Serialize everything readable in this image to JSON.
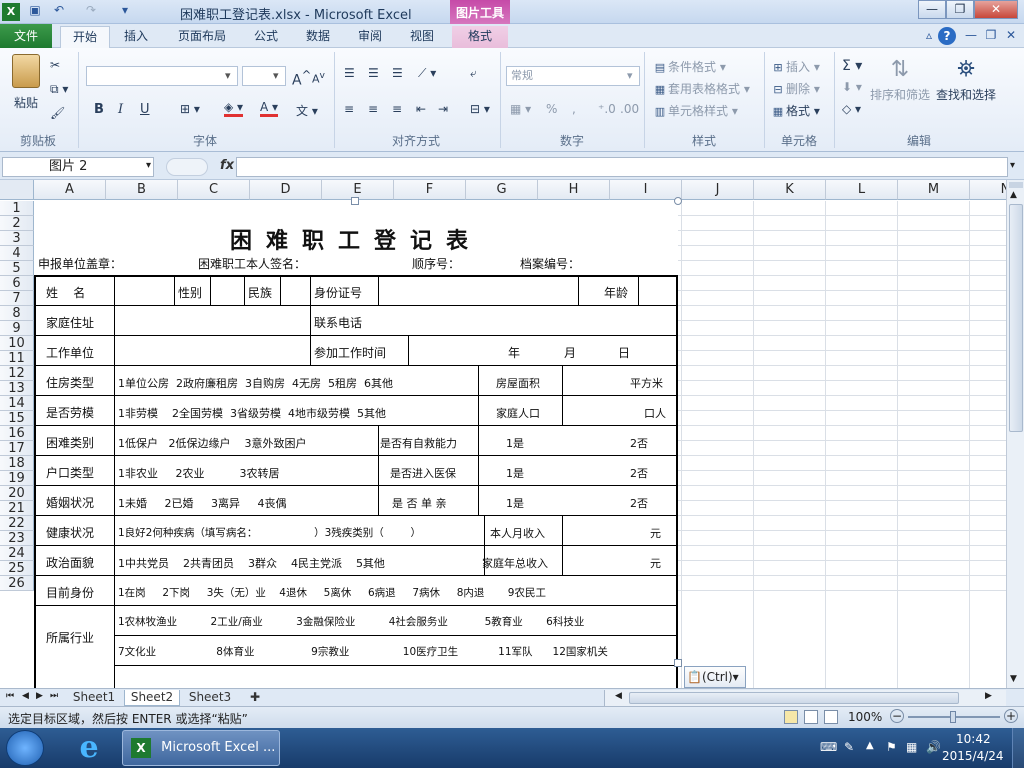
{
  "window": {
    "title": "困难职工登记表.xlsx - Microsoft Excel",
    "picture_tools": "图片工具",
    "min": "—",
    "restore": "❐",
    "close": "✕"
  },
  "tabs": {
    "file": "文件",
    "home": "开始",
    "insert": "插入",
    "page_layout": "页面布局",
    "formulas": "公式",
    "data": "数据",
    "review": "审阅",
    "view": "视图",
    "format": "格式"
  },
  "ribbon": {
    "clipboard": {
      "label": "剪贴板",
      "paste": "粘贴"
    },
    "font": {
      "label": "字体",
      "bold": "B",
      "italic": "I",
      "underline": "U",
      "grow": "A",
      "shrink": "A"
    },
    "alignment": {
      "label": "对齐方式"
    },
    "number": {
      "label": "数字",
      "format_value": "常规",
      "percent": "%"
    },
    "styles": {
      "label": "样式",
      "conditional": "条件格式",
      "table_format": "套用表格格式",
      "cell_styles": "单元格样式"
    },
    "cells": {
      "label": "单元格",
      "insert": "插入",
      "delete": "删除",
      "format": "格式"
    },
    "editing": {
      "label": "编辑",
      "sort_filter": "排序和筛选",
      "find_select": "查找和选择"
    }
  },
  "formula_bar": {
    "name_box": "图片 2",
    "fx": "fx",
    "value": ""
  },
  "columns": [
    "A",
    "B",
    "C",
    "D",
    "E",
    "F",
    "G",
    "H",
    "I",
    "J",
    "K",
    "L",
    "M",
    "N"
  ],
  "rows": [
    "1",
    "2",
    "3",
    "4",
    "5",
    "6",
    "7",
    "8",
    "9",
    "10",
    "11",
    "12",
    "13",
    "14",
    "15",
    "16",
    "17",
    "18",
    "19",
    "20",
    "21",
    "22",
    "23",
    "24",
    "25",
    "26"
  ],
  "form": {
    "title": "困难职工登记表",
    "header_line": {
      "unit_seal": "申报单位盖章：",
      "signature": "困难职工本人签名：",
      "seq": "顺序号：",
      "archive": "档案编号："
    },
    "name": "姓    名",
    "gender": "性别",
    "ethnicity": "民族",
    "id_no": "身份证号",
    "age": "年龄",
    "address": "家庭住址",
    "phone": "联系电话",
    "work_unit": "工作单位",
    "join_time": "参加工作时间",
    "year": "年",
    "month": "月",
    "day": "日",
    "housing_type": "住房类型",
    "housing_opts": "1单位公房  2政府廉租房  3自购房  4无房  5租房  6其他",
    "housing_area": "房屋面积",
    "sqm": "平方米",
    "model_worker": "是否劳模",
    "model_opts": "1非劳模    2全国劳模  3省级劳模  4地市级劳模  5其他",
    "family_pop": "家庭人口",
    "persons": "口人",
    "difficulty_type": "困难类别",
    "difficulty_opts": "1低保户   2低保边缘户    3意外致困户",
    "self_rescue": "是否有自救能力",
    "yes": "1是",
    "no": "2否",
    "hukou_type": "户口类型",
    "hukou_opts": "1非农业     2农业          3农转居",
    "medical": "是否进入医保",
    "marital": "婚姻状况",
    "marital_opts": "1未婚     2已婚     3离异     4丧偶",
    "single_parent": "是 否 单 亲",
    "health": "健康状况",
    "health_opts": "1良好2何种疾病（填写病名：                 ）3残疾类别（        ）",
    "income": "本人月收入",
    "yuan": "元",
    "political": "政治面貌",
    "political_opts": "1中共党员    2共青团员    3群众    4民主党派    5其他",
    "family_income": "家庭年总收入",
    "identity": "目前身份",
    "identity_opts": "1在岗     2下岗     3失（无）业    4退休     5离休     6病退     7病休     8内退       9农民工",
    "industry": "所属行业",
    "industry_opts_1": "1农林牧渔业          2工业/商业          3金融保险业          4社会服务业           5教育业       6科技业",
    "industry_opts_2": "7文化业                  8体育业                 9宗教业                10医疗卫生            11军队      12国家机关"
  },
  "paste_options": "(Ctrl)",
  "sheets": [
    "Sheet1",
    "Sheet2",
    "Sheet3"
  ],
  "status": {
    "message": "选定目标区域，然后按 ENTER 或选择“粘贴”",
    "zoom": "100%"
  },
  "taskbar": {
    "app": "Microsoft Excel ...",
    "time": "10:42",
    "date": "2015/4/24"
  }
}
